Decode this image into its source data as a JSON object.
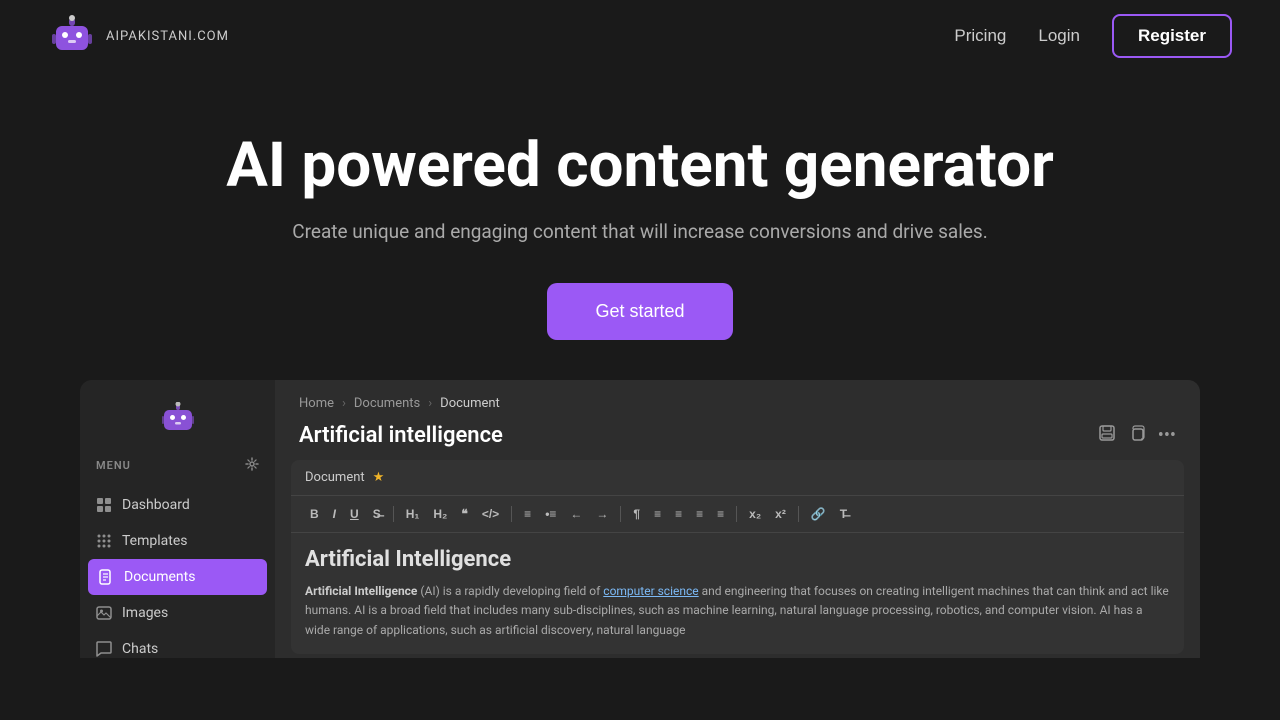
{
  "navbar": {
    "logo_text": "AIPAKISTANI.COM",
    "links": [
      {
        "id": "pricing",
        "label": "Pricing"
      },
      {
        "id": "login",
        "label": "Login"
      }
    ],
    "register_label": "Register"
  },
  "hero": {
    "title": "AI powered content generator",
    "subtitle": "Create unique and engaging content that will increase conversions and drive sales.",
    "cta_label": "Get started"
  },
  "sidebar": {
    "menu_label": "MENU",
    "items": [
      {
        "id": "dashboard",
        "label": "Dashboard",
        "icon": "grid"
      },
      {
        "id": "templates",
        "label": "Templates",
        "icon": "grid-dots"
      },
      {
        "id": "documents",
        "label": "Documents",
        "icon": "document",
        "active": true
      },
      {
        "id": "images",
        "label": "Images",
        "icon": "image"
      },
      {
        "id": "chats",
        "label": "Chats",
        "icon": "chat"
      }
    ]
  },
  "main": {
    "breadcrumb": {
      "home": "Home",
      "documents": "Documents",
      "current": "Document"
    },
    "doc_title": "Artificial intelligence",
    "editor": {
      "doc_label": "Document",
      "editor_heading": "Artificial Intelligence",
      "editor_text_bold": "Artificial Intelligence",
      "editor_text_1": " (AI) is a rapidly developing field of ",
      "editor_link": "computer science",
      "editor_text_2": " and engineering that focuses on creating intelligent machines that can think and act like humans. AI is a broad field that includes many sub-disciplines, such as machine learning, natural language processing, robotics, and computer vision. AI has a wide range of applications, such as artificial discovery, natural language"
    },
    "toolbar_buttons": [
      "B",
      "I",
      "U",
      "S",
      "H1",
      "H2",
      "«»",
      "</>",
      "≡",
      "•",
      "←",
      "→",
      "¶",
      "=",
      "≡",
      "≡",
      "≡",
      "x₂",
      "x²",
      "🔗",
      "T"
    ]
  },
  "colors": {
    "purple": "#9b59f5",
    "dark_bg": "#1a1a1a",
    "sidebar_bg": "#252525",
    "editor_bg": "#333",
    "link_color": "#7cb9f5"
  }
}
